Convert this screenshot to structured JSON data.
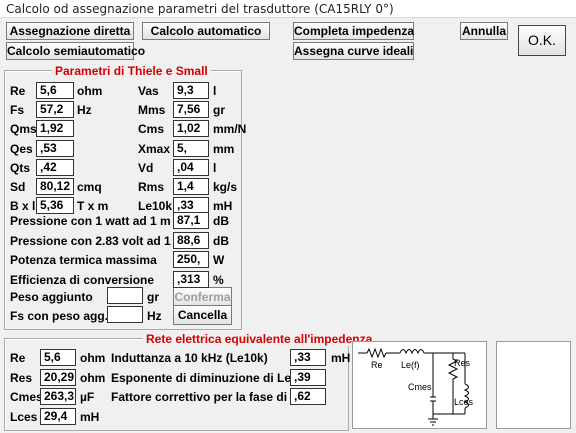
{
  "window": {
    "title": "Calcolo od assegnazione parametri del trasduttore (CA15RLY 0°)"
  },
  "toolbar": {
    "assegnazione": "Assegnazione diretta",
    "calcolo_auto": "Calcolo automatico",
    "completa": "Completa impedenza",
    "annulla": "Annulla",
    "ok": "O.K.",
    "semiauto": "Calcolo semiautomatico",
    "curve": "Assegna curve ideali"
  },
  "thiele": {
    "title": "Parametri di Thiele e Small",
    "left": [
      {
        "label": "Re",
        "value": "5,6",
        "unit": "ohm"
      },
      {
        "label": "Fs",
        "value": "57,2",
        "unit": "Hz"
      },
      {
        "label": "Qms",
        "value": "1,92",
        "unit": ""
      },
      {
        "label": "Qes",
        "value": ",53",
        "unit": ""
      },
      {
        "label": "Qts",
        "value": ",42",
        "unit": ""
      },
      {
        "label": "Sd",
        "value": "80,12",
        "unit": "cmq"
      },
      {
        "label": "B x l",
        "value": "5,36",
        "unit": "T x m"
      }
    ],
    "right": [
      {
        "label": "Vas",
        "value": "9,3",
        "unit": "l"
      },
      {
        "label": "Mms",
        "value": "7,56",
        "unit": "gr"
      },
      {
        "label": "Cms",
        "value": "1,02",
        "unit": "mm/N"
      },
      {
        "label": "Xmax",
        "value": "5,",
        "unit": "mm"
      },
      {
        "label": "Vd",
        "value": ",04",
        "unit": "l"
      },
      {
        "label": "Rms",
        "value": "1,4",
        "unit": "kg/s"
      },
      {
        "label": "Le10k",
        "value": ",33",
        "unit": "mH"
      }
    ],
    "wide": [
      {
        "label": "Pressione con 1 watt ad 1 m",
        "value": "87,1",
        "unit": "dB"
      },
      {
        "label": "Pressione con 2.83 volt ad 1 m",
        "value": "88,6",
        "unit": "dB"
      },
      {
        "label": "Potenza termica massima",
        "value": "250,",
        "unit": "W"
      },
      {
        "label": "Efficienza di conversione",
        "value": ",313",
        "unit": "%"
      }
    ],
    "peso_label": "Peso aggiunto",
    "peso_unit": "gr",
    "peso_value": "",
    "fs_label": "Fs con peso agg.",
    "fs_unit": "Hz",
    "fs_value": "",
    "conferma": "Conferma",
    "cancella": "Cancella"
  },
  "rete": {
    "title": "Rete elettrica equivalente all'impedenza",
    "left": [
      {
        "label": "Re",
        "value": "5,6",
        "unit": "ohm"
      },
      {
        "label": "Res",
        "value": "20,29",
        "unit": "ohm"
      },
      {
        "label": "Cmes",
        "value": "263,3",
        "unit": "µF"
      },
      {
        "label": "Lces",
        "value": "29,4",
        "unit": "mH"
      }
    ],
    "right": [
      {
        "label": "Induttanza a 10 kHz (Le10k)",
        "value": ",33",
        "unit": "mH"
      },
      {
        "label": "Esponente di diminuzione di Le",
        "value": ",39",
        "unit": ""
      },
      {
        "label": "Fattore correttivo per la fase di Le",
        "value": ",62",
        "unit": ""
      }
    ],
    "circuit": {
      "re": "Re",
      "le": "Le(f)",
      "res": "Res",
      "cmes": "Cmes",
      "lces": "Lces"
    }
  }
}
